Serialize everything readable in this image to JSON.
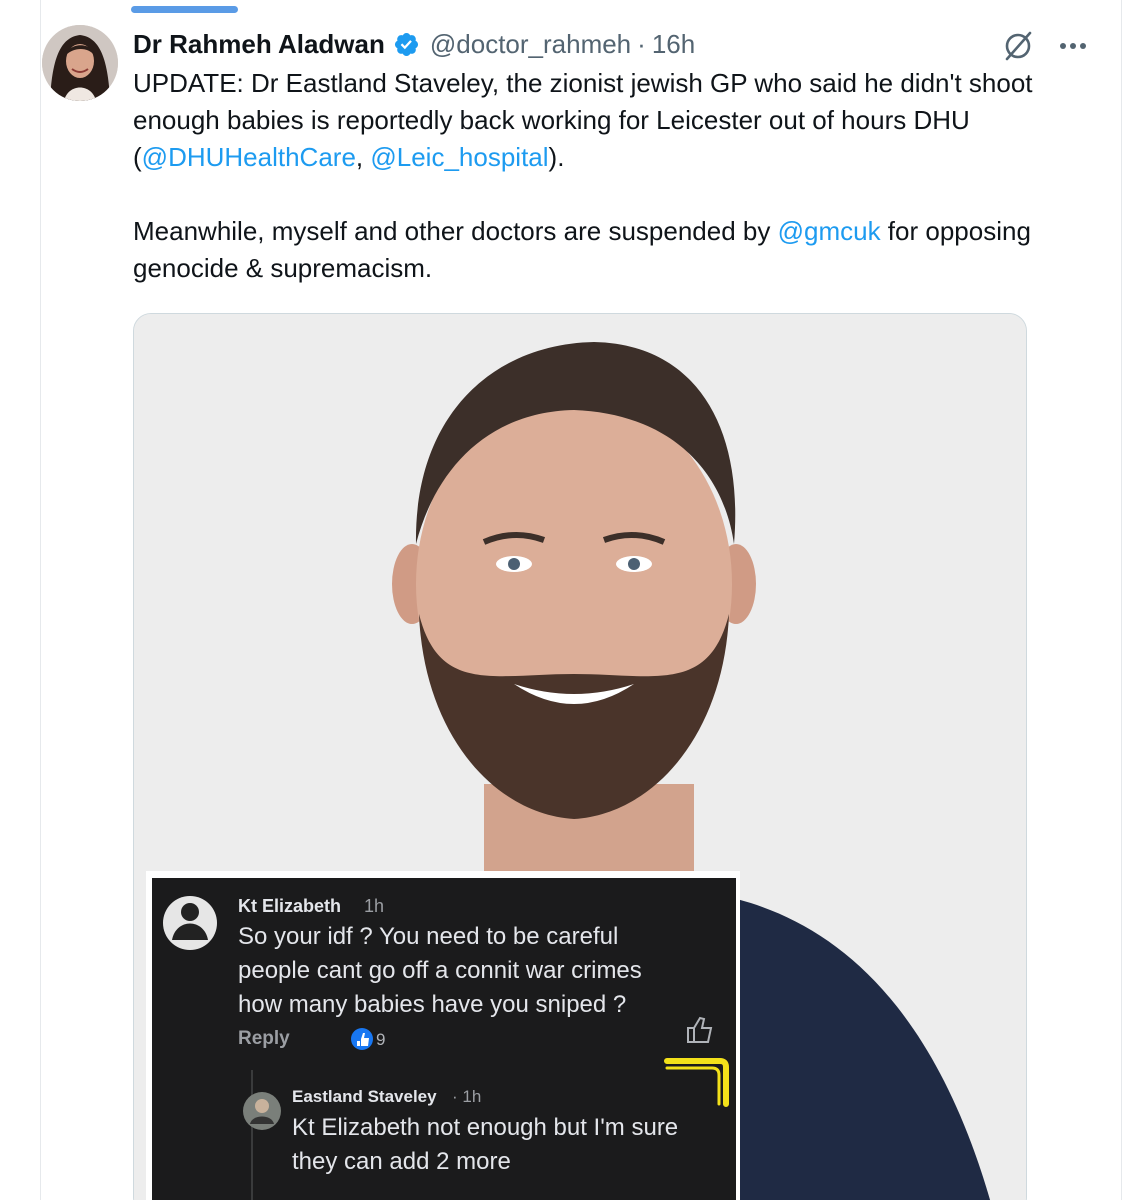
{
  "tweet": {
    "display_name": "Dr Rahmeh Aladwan",
    "handle": "@doctor_rahmeh",
    "separator": "·",
    "time": "16h",
    "icons": [
      "verified-badge-icon",
      "grok-icon",
      "more-icon"
    ],
    "text": {
      "p1_a": "UPDATE: Dr Eastland Staveley, the zionist jewish GP who said he didn't shoot enough babies is reportedly back working for Leicester out of hours DHU (",
      "mention_1": "@DHUHealthCare",
      "p1_b": ", ",
      "mention_2": "@Leic_hospital",
      "p1_c": ").",
      "p2_a": "Meanwhile, myself and other doctors are suspended by ",
      "mention_3": "@gmcuk",
      "p2_b": " for opposing genocide & supremacism."
    }
  },
  "screenshot": {
    "comment": {
      "author": "Kt Elizabeth",
      "time": "1h",
      "text": "So your idf ? You need to be careful\npeople cant go off a connit war crimes\nhow many babies have you sniped ?",
      "reply_label": "Reply",
      "like_count": "9"
    },
    "reply": {
      "author": "Eastland Staveley",
      "time": "· 1h",
      "text": "Kt Elizabeth not enough but I'm sure\nthey can add 2 more"
    }
  },
  "colors": {
    "link": "#1d9bf0",
    "verified": "#1d9bf0",
    "highlight": "#f3e11a"
  }
}
